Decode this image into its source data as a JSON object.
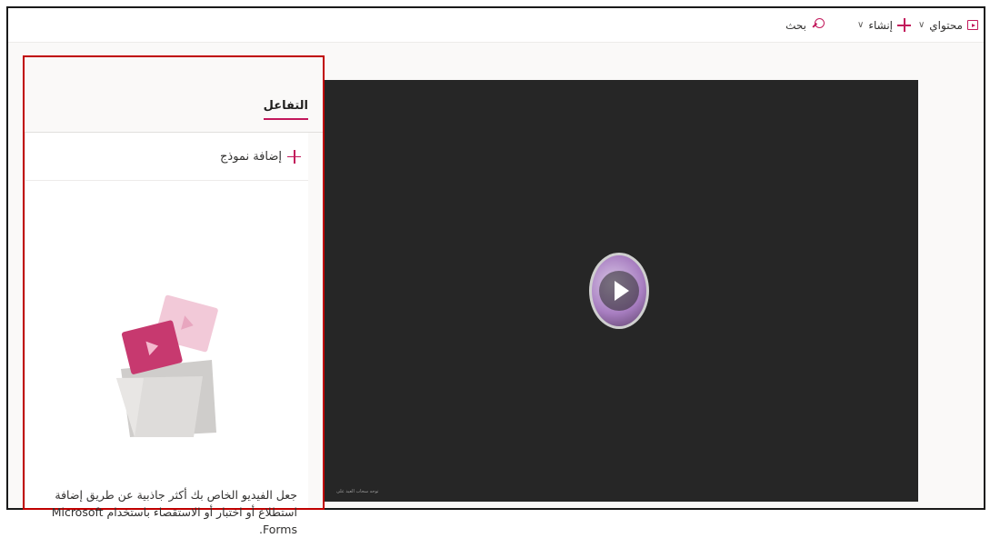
{
  "topbar": {
    "content_label": "محتواي",
    "create_label": "إنشاء",
    "search_label": "بحث"
  },
  "panel": {
    "tab_label": "التفاعل",
    "add_form_label": "إضافة نموذج",
    "description": "جعل الفيديو الخاص بك أكثر جاذبية عن طريق إضافة استطلاع أو اختبار أو الاستقصاء باستخدام Microsoft Forms."
  },
  "video": {
    "caption": "توحه سحاب العيد على"
  },
  "colors": {
    "accent": "#c2185b",
    "highlight_border": "#c00000",
    "video_bg": "#262626"
  },
  "icons": [
    "stream-icon",
    "chevron-down-icon",
    "plus-icon",
    "search-icon",
    "play-icon"
  ]
}
